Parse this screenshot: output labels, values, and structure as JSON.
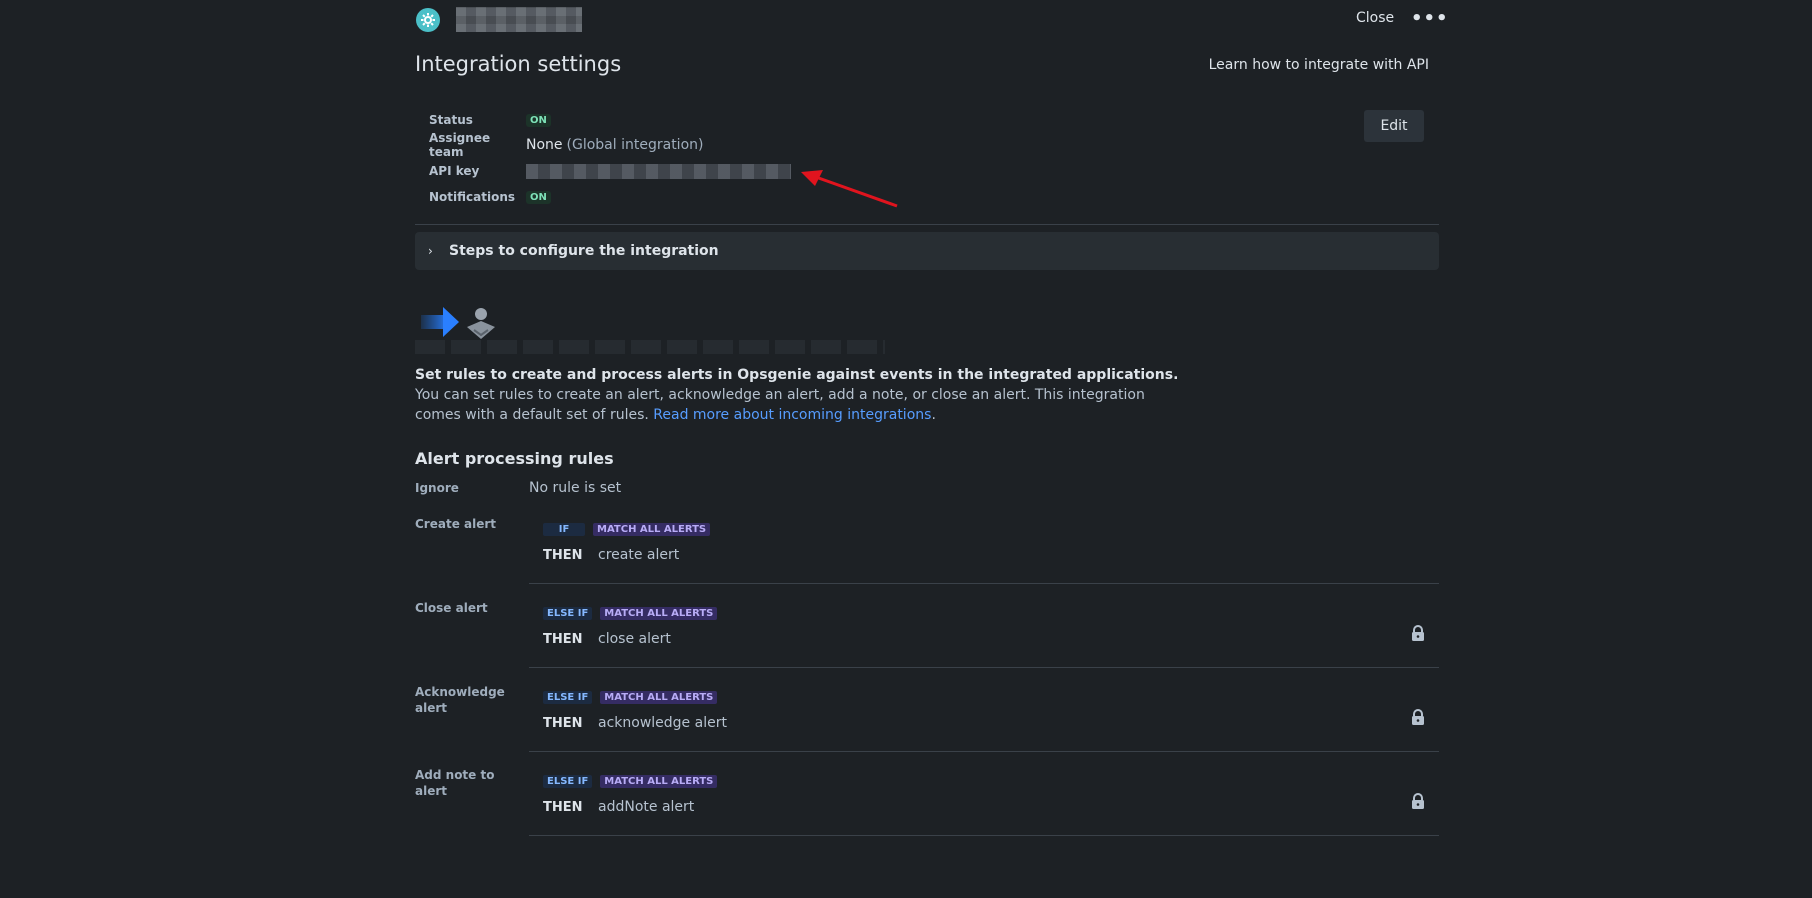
{
  "header": {
    "close_label": "Close",
    "more_icon": "more-horizontal-icon"
  },
  "page": {
    "title": "Integration settings",
    "learn_link": "Learn how to integrate with API"
  },
  "settings": {
    "status_label": "Status",
    "status_value": "ON",
    "assignee_label": "Assignee team",
    "assignee_value": "None",
    "assignee_note": "(Global integration)",
    "api_key_label": "API key",
    "notifications_label": "Notifications",
    "notifications_value": "ON",
    "edit_label": "Edit"
  },
  "steps": {
    "label": "Steps to configure the integration"
  },
  "intro": {
    "bold": "Set rules to create and process alerts in Opsgenie against events in the integrated applications.",
    "text": " You can set rules to create an alert, acknowledge an alert, add a note, or close an alert. This integration comes with a default set of rules. ",
    "link": "Read more about incoming integrations",
    "tail": "."
  },
  "rules": {
    "title": "Alert processing rules",
    "ignore_label": "Ignore",
    "ignore_value": "No rule is set",
    "then_label": "THEN",
    "match_label": "MATCH ALL ALERTS",
    "items": [
      {
        "label": "Create alert",
        "cond": "IF",
        "action": "create alert"
      },
      {
        "label": "Close alert",
        "cond": "ELSE IF",
        "action": "close alert"
      },
      {
        "label": "Acknowledge alert",
        "cond": "ELSE IF",
        "action": "acknowledge alert"
      },
      {
        "label": "Add note to alert",
        "cond": "ELSE IF",
        "action": "addNote alert"
      }
    ]
  },
  "colors": {
    "background": "#1d2125",
    "on_badge": "#7ee2b8",
    "link": "#579dff",
    "arrow": "#e0141e"
  }
}
